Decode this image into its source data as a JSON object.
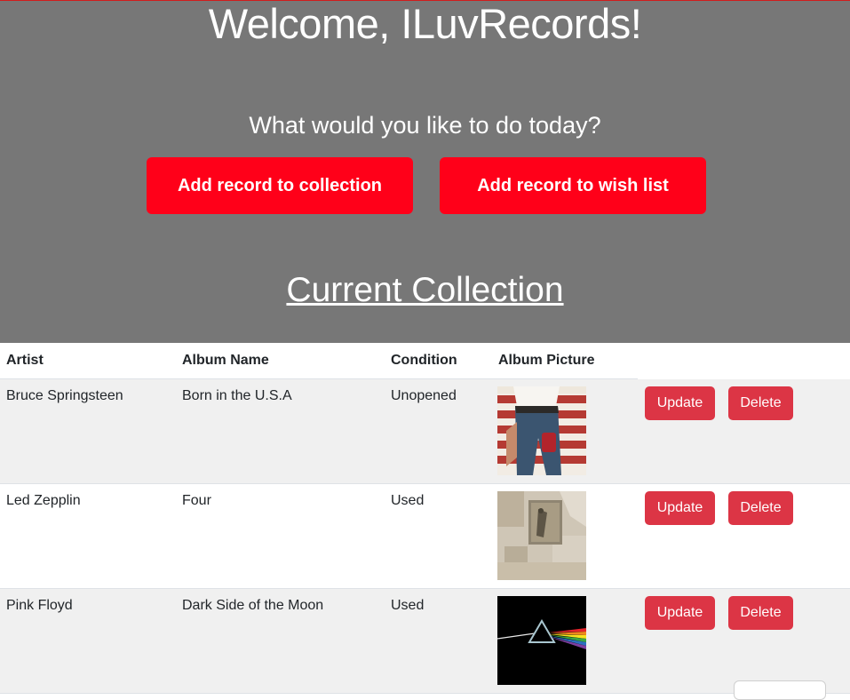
{
  "hero": {
    "welcome": "Welcome, ILuvRecords!",
    "question": "What would you like to do today?",
    "add_collection_label": "Add record to collection",
    "add_wishlist_label": "Add record to wish list",
    "section_title": "Current Collection"
  },
  "table": {
    "headers": [
      "Artist",
      "Album Name",
      "Condition",
      "Album Picture"
    ],
    "rows": [
      {
        "artist": "Bruce Springsteen",
        "album": "Born in the U.S.A",
        "condition": "Unopened",
        "update_label": "Update",
        "delete_label": "Delete"
      },
      {
        "artist": "Led Zepplin",
        "album": "Four",
        "condition": "Used",
        "update_label": "Update",
        "delete_label": "Delete"
      },
      {
        "artist": "Pink Floyd",
        "album": "Dark Side of the Moon",
        "condition": "Used",
        "update_label": "Update",
        "delete_label": "Delete"
      }
    ]
  },
  "colors": {
    "hero_bg": "#777777",
    "action_red": "#ff0019",
    "row_button_red": "#dc3545",
    "row_shade": "#f0f0f0"
  }
}
